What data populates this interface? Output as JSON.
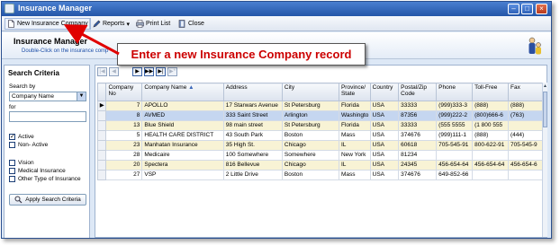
{
  "window": {
    "title": "Insurance Manager",
    "buttons": {
      "minimize": "–",
      "maximize": "□",
      "close": "×"
    }
  },
  "toolbar": {
    "new_company_label": "New Insurance Company",
    "reports_label": "Reports",
    "reports_arrow": "▾",
    "print_list_label": "Print List",
    "close_label": "Close"
  },
  "header": {
    "title": "Insurance Manager",
    "subtitle": "Double-Click on the insurance comp"
  },
  "callout": {
    "text": "Enter a new Insurance Company record"
  },
  "sidebar": {
    "title": "Search Criteria",
    "search_by_label": "Search by",
    "search_by_value": "Company Name",
    "for_label": "for",
    "for_value": "",
    "filters": [
      {
        "label": "Active",
        "checked": true
      },
      {
        "label": "Non- Active",
        "checked": false
      },
      {
        "label": "Vision",
        "checked": false
      },
      {
        "label": "Medical Insurance",
        "checked": false
      },
      {
        "label": "Other Type of Insurance",
        "checked": false
      }
    ],
    "apply_label": "Apply Search Criteria"
  },
  "nav": {
    "first": "|◀",
    "prev": "◀",
    "next": "▶",
    "next_page": "▶▶",
    "last": "▶|",
    "new": "▶*"
  },
  "grid": {
    "columns": [
      "Company No",
      "Company Name",
      "Address",
      "City",
      "Province/ State",
      "Country",
      "Postal/Zip Code",
      "Phone",
      "Toll-Free",
      "Fax"
    ],
    "sort_indicator": "▲",
    "current_row_marker": "▶",
    "rows": [
      [
        "7",
        "APOLLO",
        "17 Starwars Avenue",
        "St Petersburg",
        "Florida",
        "USA",
        "33333",
        "(999)333-3",
        "(888)",
        "(888)"
      ],
      [
        "8",
        "AVMED",
        "333 Saint Street",
        "Arlington",
        "Washingto",
        "USA",
        "87356",
        "(999)222-2",
        "(800)666-6",
        "(763)"
      ],
      [
        "13",
        "Blue Shield",
        "98 main street",
        "St Petersburg",
        "Florida",
        "USA",
        "33333",
        "(555 5555",
        "(1 800 555",
        ""
      ],
      [
        "5",
        "HEALTH CARE DISTRICT",
        "43 South Park",
        "Boston",
        "Mass",
        "USA",
        "374676",
        "(999)111-1",
        "(888)",
        "(444)"
      ],
      [
        "23",
        "Manhatan Insurance",
        "35 High St.",
        "Chicago",
        "IL",
        "USA",
        "60618",
        "705-545-91",
        "800-622-91",
        "705-545-9"
      ],
      [
        "28",
        "Medicaire",
        "100 Somewhere",
        "Somewhere",
        "New York",
        "USA",
        "81234",
        "",
        "",
        ""
      ],
      [
        "20",
        "Spectera",
        "816 Bellevue",
        "Chicago",
        "IL",
        "USA",
        "24345",
        "456-654-64",
        "456-654-64",
        "456-654-6"
      ],
      [
        "27",
        "VSP",
        "2 Little Drive",
        "Boston",
        "Mass",
        "USA",
        "374676",
        "649-852-66",
        "",
        ""
      ]
    ]
  },
  "colors": {
    "accent": "#2456a8",
    "callout_text": "#cc0000",
    "selected_row": "#c5d6f0",
    "alt_row": "#f8f3d5"
  }
}
